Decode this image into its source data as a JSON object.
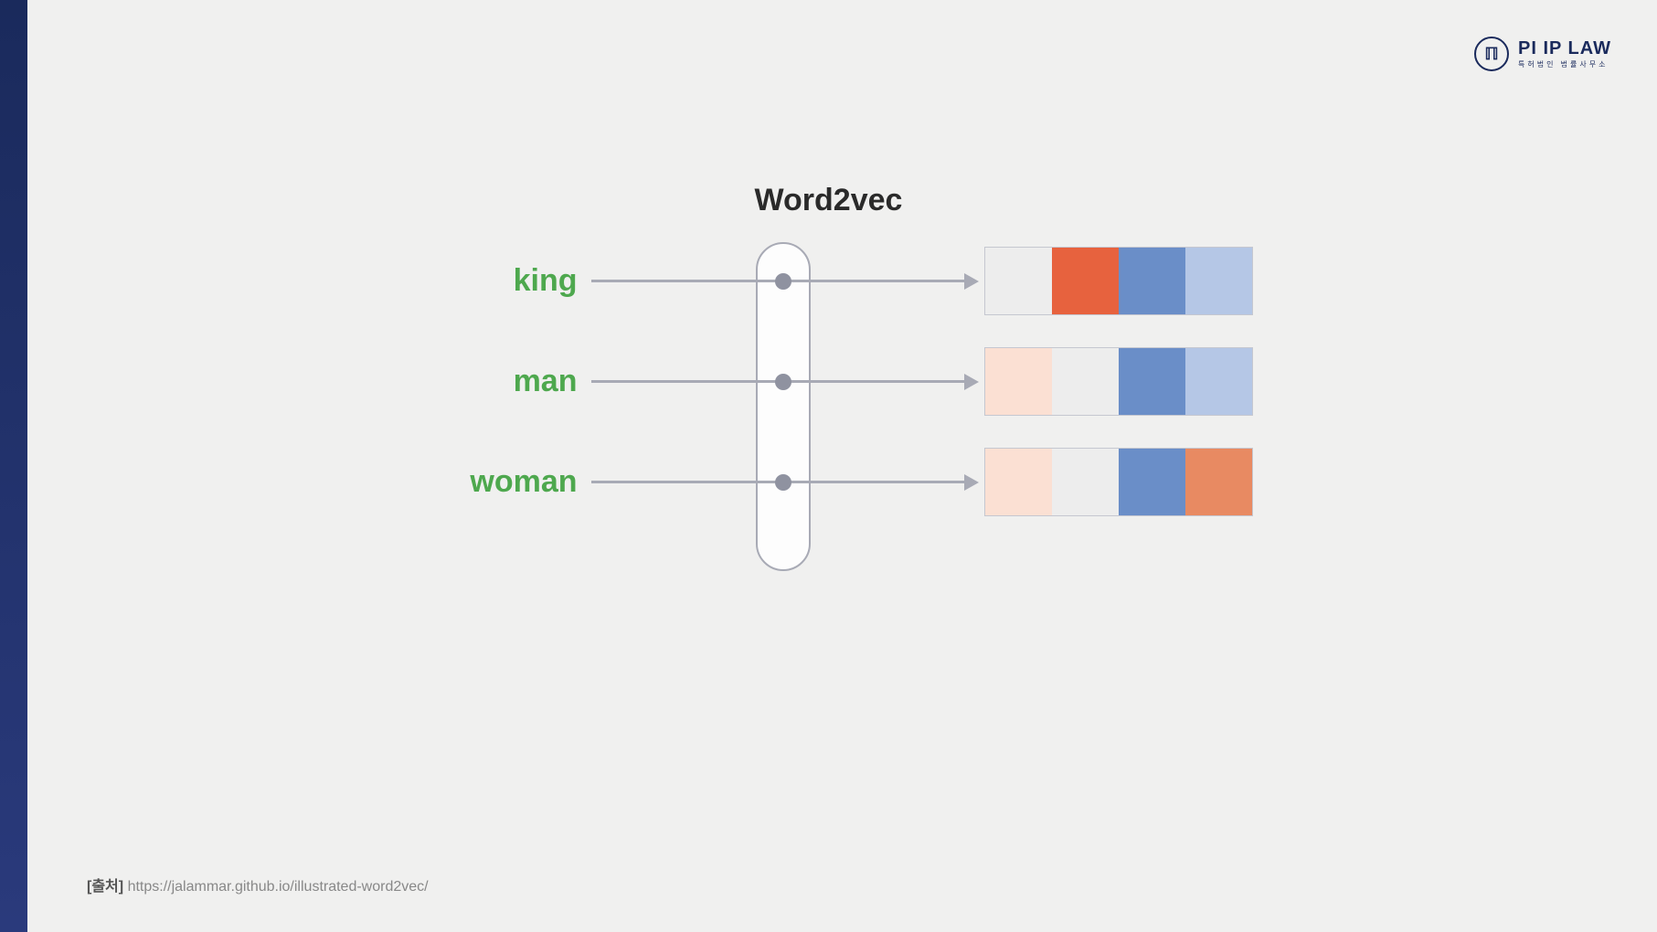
{
  "logo": {
    "symbol": "ℿ",
    "main": "PI IP LAW",
    "sub": "특허법인 법률사무소"
  },
  "diagram": {
    "title": "Word2vec",
    "rows": [
      {
        "label": "king",
        "vector_colors": [
          "#ededed",
          "#e7623e",
          "#6a8ec8",
          "#b5c7e6"
        ]
      },
      {
        "label": "man",
        "vector_colors": [
          "#fbe0d3",
          "#ededed",
          "#6a8ec8",
          "#b5c7e6"
        ]
      },
      {
        "label": "woman",
        "vector_colors": [
          "#fbe0d3",
          "#ededed",
          "#6a8ec8",
          "#e88a62"
        ]
      }
    ]
  },
  "source": {
    "label": "[출처]",
    "url": "https://jalammar.github.io/illustrated-word2vec/"
  }
}
